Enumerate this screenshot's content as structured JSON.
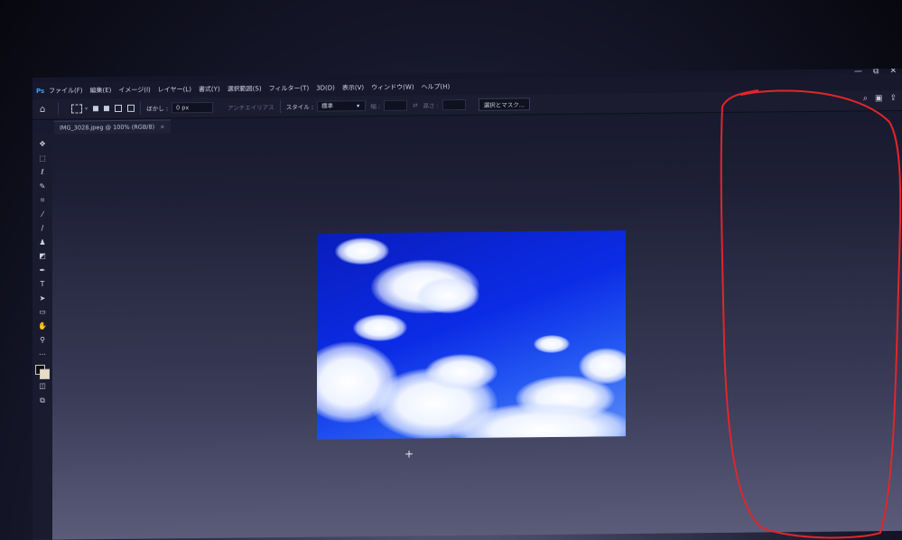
{
  "menubar": {
    "items": [
      "ファイル(F)",
      "編集(E)",
      "イメージ(I)",
      "レイヤー(L)",
      "書式(Y)",
      "選択範囲(S)",
      "フィルター(T)",
      "3D(D)",
      "表示(V)",
      "ウィンドウ(W)",
      "ヘルプ(H)"
    ],
    "window_controls": [
      "—",
      "⧉",
      "✕"
    ]
  },
  "options": {
    "feather_label": "ぼかし :",
    "feather_value": "0 px",
    "antialias_label": "アンチエイリアス",
    "style_label": "スタイル :",
    "style_value": "標準",
    "width_label": "幅 :",
    "height_label": "高さ :",
    "select_mask_label": "選択とマスク..."
  },
  "tab": {
    "title": "IMG_3028.jpeg @ 100% (RGB/8)",
    "close": "×"
  },
  "tools": [
    "move-icon",
    "marquee-icon",
    "lasso-icon",
    "quick-select-icon",
    "crop-icon",
    "eyedropper-icon",
    "brush-icon",
    "stamp-icon",
    "eraser-icon",
    "pen-icon",
    "type-icon",
    "path-select-icon",
    "rectangle-icon",
    "hand-icon",
    "zoom-icon",
    "more-icon"
  ],
  "colors": {
    "annotation_stroke": "#e0262b",
    "sky_blue": "#0b2ce6"
  }
}
